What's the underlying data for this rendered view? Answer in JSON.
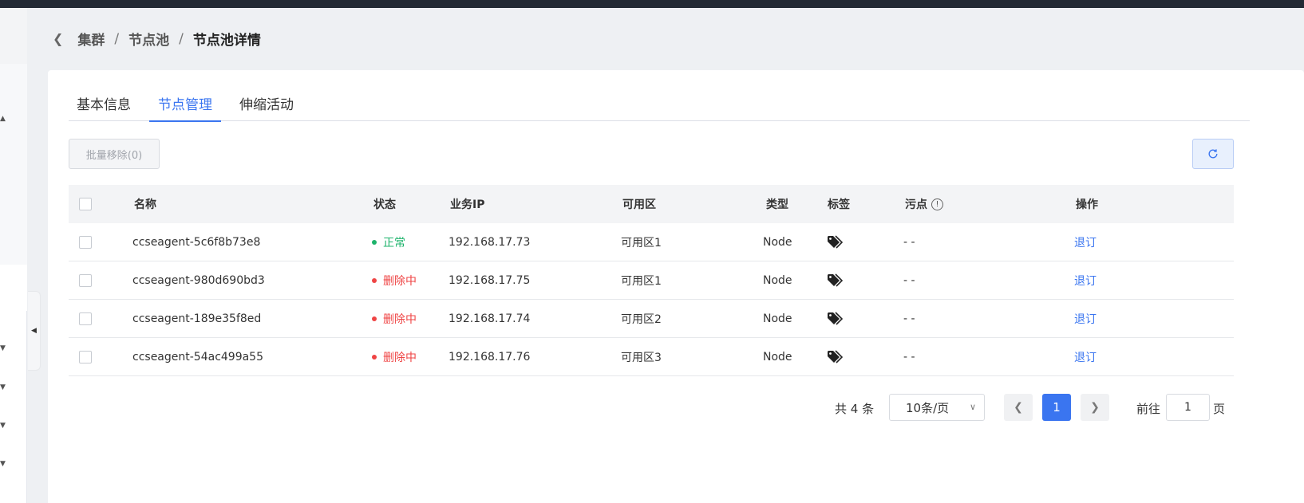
{
  "breadcrumb": {
    "items": [
      "集群",
      "节点池"
    ],
    "separator": "/",
    "current": "节点池详情"
  },
  "tabs": [
    {
      "label": "基本信息",
      "active": false
    },
    {
      "label": "节点管理",
      "active": true
    },
    {
      "label": "伸缩活动",
      "active": false
    }
  ],
  "toolbar": {
    "batch_remove_label": "批量移除(0)",
    "refresh_icon": "refresh-icon"
  },
  "table": {
    "headers": {
      "name": "名称",
      "status": "状态",
      "ip": "业务IP",
      "zone": "可用区",
      "type": "类型",
      "tags": "标签",
      "taint": "污点",
      "operation": "操作"
    },
    "rows": [
      {
        "name": "ccseagent-5c6f8b73e8",
        "status": "正常",
        "status_color": "#1db36b",
        "ip": "192.168.17.73",
        "zone": "可用区1",
        "type": "Node",
        "taint": "- -",
        "operation": "退订"
      },
      {
        "name": "ccseagent-980d690bd3",
        "status": "删除中",
        "status_color": "#ef4444",
        "ip": "192.168.17.75",
        "zone": "可用区1",
        "type": "Node",
        "taint": "- -",
        "operation": "退订"
      },
      {
        "name": "ccseagent-189e35f8ed",
        "status": "删除中",
        "status_color": "#ef4444",
        "ip": "192.168.17.74",
        "zone": "可用区2",
        "type": "Node",
        "taint": "- -",
        "operation": "退订"
      },
      {
        "name": "ccseagent-54ac499a55",
        "status": "删除中",
        "status_color": "#ef4444",
        "ip": "192.168.17.76",
        "zone": "可用区3",
        "type": "Node",
        "taint": "- -",
        "operation": "退订"
      }
    ]
  },
  "pagination": {
    "total": "共 4 条",
    "page_size": "10条/页",
    "current_page": "1",
    "goto_label": "前往",
    "goto_value": "1",
    "page_unit": "页"
  },
  "colors": {
    "accent": "#3a75f0",
    "ok": "#1db36b",
    "deleting": "#ef4444"
  }
}
